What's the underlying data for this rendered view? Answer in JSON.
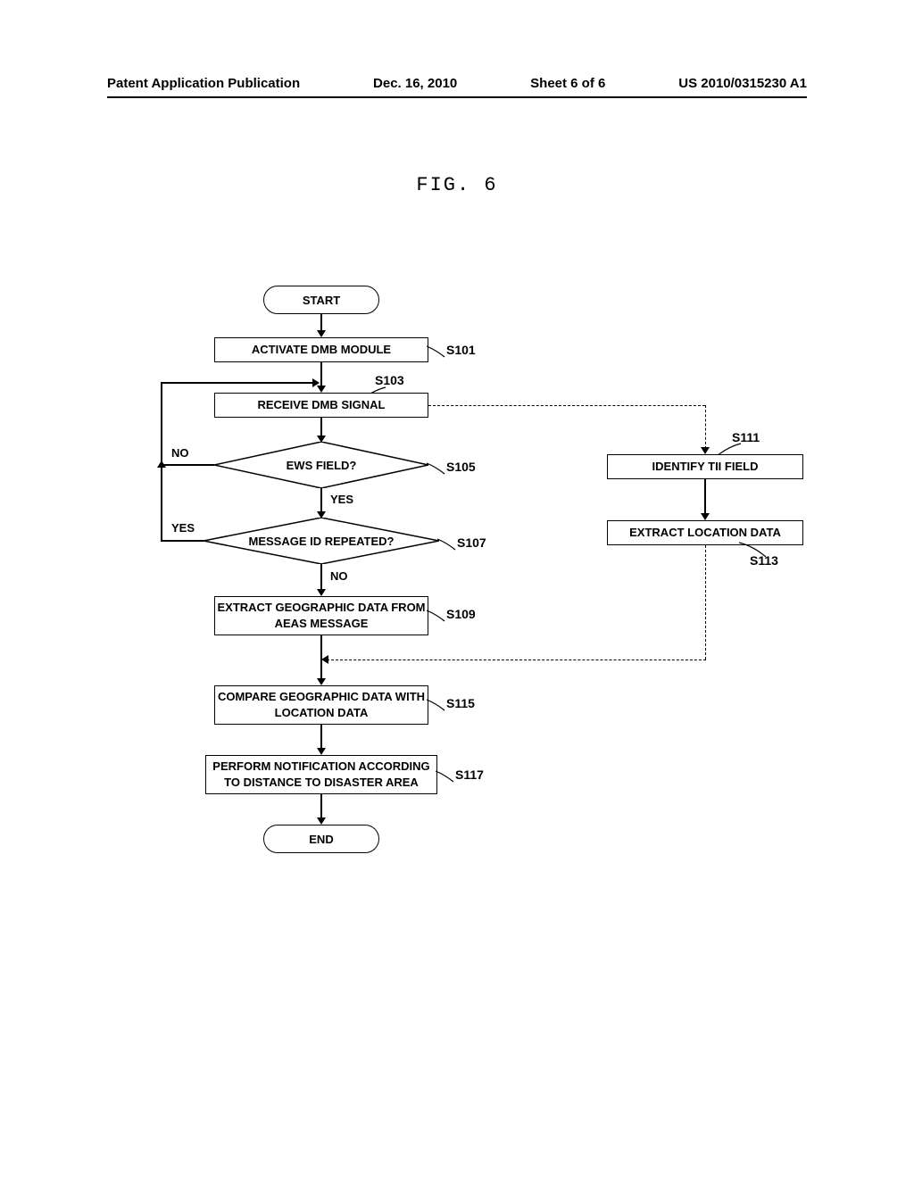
{
  "header": {
    "left": "Patent Application Publication",
    "date": "Dec. 16, 2010",
    "sheet": "Sheet 6 of 6",
    "docnum": "US 2010/0315230 A1"
  },
  "figure": {
    "title": "FIG. 6"
  },
  "flowchart": {
    "start": "START",
    "end": "END",
    "s101": "ACTIVATE DMB MODULE",
    "s103": "RECEIVE DMB SIGNAL",
    "s105": "EWS FIELD?",
    "s107": "MESSAGE ID REPEATED?",
    "s109": "EXTRACT GEOGRAPHIC DATA FROM AEAS MESSAGE",
    "s111": "IDENTIFY TII FIELD",
    "s113": "EXTRACT LOCATION DATA",
    "s115": "COMPARE GEOGRAPHIC DATA WITH LOCATION DATA",
    "s117": "PERFORM NOTIFICATION ACCORDING TO DISTANCE TO DISASTER AREA",
    "yes": "YES",
    "no": "NO"
  },
  "steps": {
    "s101": "S101",
    "s103": "S103",
    "s105": "S105",
    "s107": "S107",
    "s109": "S109",
    "s111": "S111",
    "s113": "S113",
    "s115": "S115",
    "s117": "S117"
  }
}
